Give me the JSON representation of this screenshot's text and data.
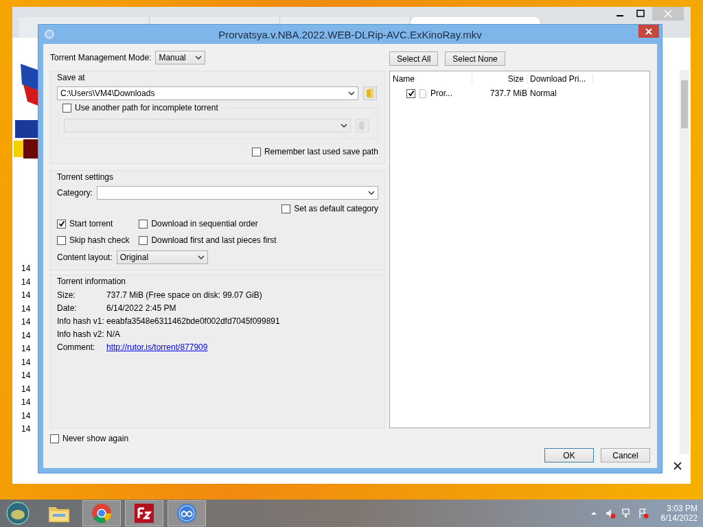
{
  "browser": {
    "tabs": [
      {
        "selected": false
      },
      {
        "selected": false
      },
      {
        "selected": false
      },
      {
        "selected": true
      }
    ],
    "row_numbers": [
      "14",
      "14",
      "14",
      "14",
      "14",
      "14",
      "14",
      "14",
      "14",
      "14",
      "14",
      "14",
      "14"
    ]
  },
  "dialog": {
    "title": "Prorvatsya.v.NBA.2022.WEB-DLRip-AVC.ExKinoRay.mkv",
    "management_mode": {
      "label": "Torrent Management Mode:",
      "value": "Manual"
    },
    "save_at": {
      "title": "Save at",
      "path": "C:\\Users\\VM4\\Downloads",
      "incomplete": {
        "label": "Use another path for incomplete torrent",
        "checked": false
      },
      "remember": {
        "label": "Remember last used save path",
        "checked": false
      }
    },
    "torrent_settings": {
      "title": "Torrent settings",
      "category_label": "Category:",
      "default_category": {
        "label": "Set as default category",
        "checked": false
      },
      "options": [
        {
          "label": "Start torrent",
          "checked": true
        },
        {
          "label": "Download in sequential order",
          "checked": false
        },
        {
          "label": "Skip hash check",
          "checked": false
        },
        {
          "label": "Download first and last pieces first",
          "checked": false
        }
      ],
      "content_layout": {
        "label": "Content layout:",
        "value": "Original"
      }
    },
    "torrent_information": {
      "title": "Torrent information",
      "rows": [
        {
          "label": "Size:",
          "value": "737.7 MiB (Free space on disk: 99.07 GiB)",
          "kind": "text"
        },
        {
          "label": "Date:",
          "value": "6/14/2022 2:45 PM",
          "kind": "text"
        },
        {
          "label": "Info hash v1:",
          "value": "eeabfa3548e6311462bde0f002dfd7045f099891",
          "kind": "text"
        },
        {
          "label": "Info hash v2:",
          "value": "N/A",
          "kind": "text"
        },
        {
          "label": "Comment:",
          "value": "http://rutor.is/torrent/877909",
          "kind": "link"
        }
      ]
    },
    "never_show_again": {
      "label": "Never show again",
      "checked": false
    },
    "file_buttons": [
      "Select All",
      "Select None"
    ],
    "files": {
      "columns": [
        "Name",
        "Size",
        "Download Pri..."
      ],
      "rows": [
        {
          "checked": true,
          "name": "Pror...",
          "size": "737.7 MiB",
          "priority": "Normal"
        }
      ]
    },
    "buttons": [
      "OK",
      "Cancel"
    ]
  },
  "taskbar": {
    "apps": [
      {
        "kind": "explorer",
        "selected": false
      },
      {
        "kind": "chrome",
        "selected": true
      },
      {
        "kind": "filezilla",
        "selected": true
      },
      {
        "kind": "qbittorrent",
        "selected": true
      }
    ],
    "time": "3:03 PM",
    "date": "6/14/2022"
  }
}
